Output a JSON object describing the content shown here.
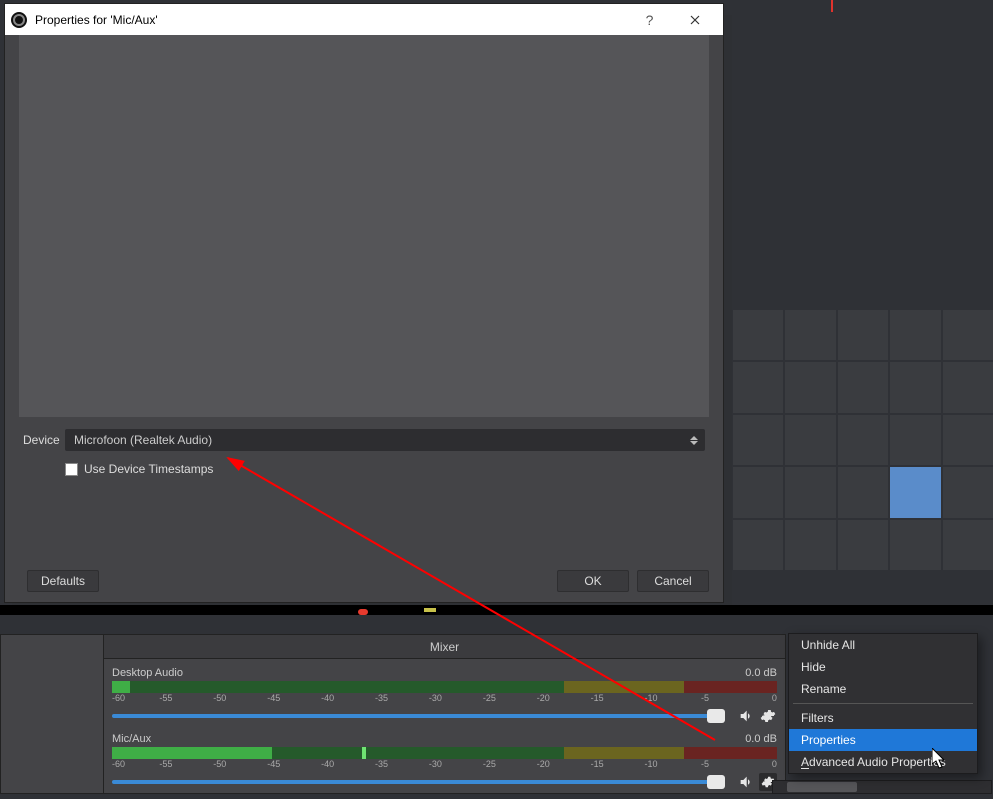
{
  "dialog": {
    "title": "Properties for 'Mic/Aux'",
    "device_label": "Device",
    "device_value": "Microfoon (Realtek Audio)",
    "use_timestamps_label": "Use Device Timestamps",
    "defaults_btn": "Defaults",
    "ok_btn": "OK",
    "cancel_btn": "Cancel"
  },
  "mixer": {
    "title": "Mixer",
    "channels": [
      {
        "name": "Desktop Audio",
        "level_db": "0.0 dB"
      },
      {
        "name": "Mic/Aux",
        "level_db": "0.0 dB"
      }
    ],
    "ticks": [
      "-60",
      "-55",
      "-50",
      "-45",
      "-40",
      "-35",
      "-30",
      "-25",
      "-20",
      "-15",
      "-10",
      "-5",
      "0"
    ]
  },
  "context_menu": {
    "items": [
      {
        "label": "Unhide All"
      },
      {
        "label": "Hide"
      },
      {
        "label": "Rename"
      },
      {
        "sep": true
      },
      {
        "label": "Filters"
      },
      {
        "label": "Properties",
        "hover": true
      },
      {
        "label": "Advanced Audio Properties",
        "underline_first": true
      }
    ]
  }
}
